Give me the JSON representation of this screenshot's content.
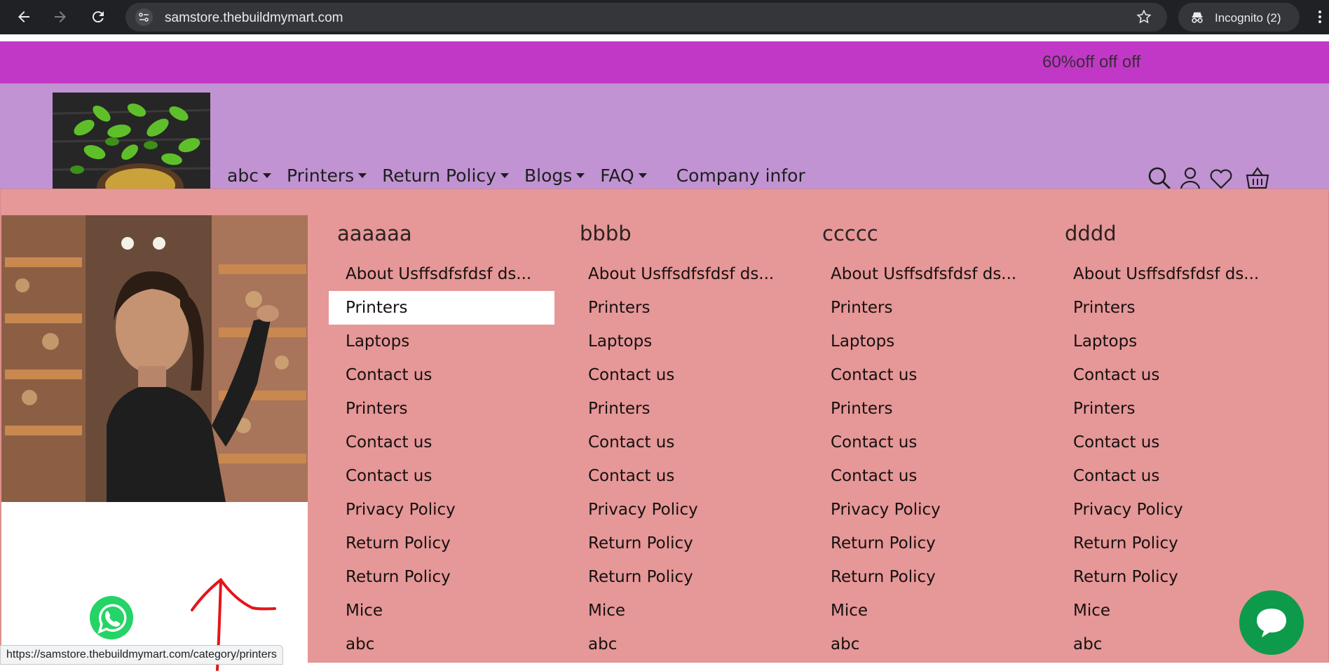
{
  "browser": {
    "url": "samstore.thebuildmymart.com",
    "incognito_label": "Incognito (2)",
    "status_url": "https://samstore.thebuildmymart.com/category/printers"
  },
  "promo": {
    "text": "60%off off off"
  },
  "nav": {
    "items": [
      {
        "label": "abc",
        "dropdown": true
      },
      {
        "label": "Printers",
        "dropdown": true
      },
      {
        "label": "Return Policy",
        "dropdown": true
      },
      {
        "label": "Blogs",
        "dropdown": true
      },
      {
        "label": "FAQ",
        "dropdown": true
      },
      {
        "label": "Company infor",
        "dropdown": false
      }
    ]
  },
  "header_icons": [
    "search-icon",
    "user-icon",
    "heart-icon",
    "basket-icon"
  ],
  "mega_menu": {
    "columns": [
      {
        "title": "aaaaaa",
        "links": [
          "About Usffsdfsfdsf ds...",
          "Printers",
          "Laptops",
          "Contact us",
          "Printers",
          "Contact us",
          "Contact us",
          "Privacy Policy",
          "Return Policy",
          "Return Policy",
          "Mice",
          "abc"
        ]
      },
      {
        "title": "bbbb",
        "links": [
          "About Usffsdfsfdsf ds...",
          "Printers",
          "Laptops",
          "Contact us",
          "Printers",
          "Contact us",
          "Contact us",
          "Privacy Policy",
          "Return Policy",
          "Return Policy",
          "Mice",
          "abc"
        ]
      },
      {
        "title": "ccccc",
        "links": [
          "About Usffsdfsfdsf ds...",
          "Printers",
          "Laptops",
          "Contact us",
          "Printers",
          "Contact us",
          "Contact us",
          "Privacy Policy",
          "Return Policy",
          "Return Policy",
          "Mice",
          "abc"
        ]
      },
      {
        "title": "dddd",
        "links": [
          "About Usffsdfsfdsf ds...",
          "Printers",
          "Laptops",
          "Contact us",
          "Printers",
          "Contact us",
          "Contact us",
          "Privacy Policy",
          "Return Policy",
          "Return Policy",
          "Mice",
          "abc"
        ]
      }
    ],
    "hovered": {
      "column": 0,
      "link": 1
    }
  },
  "colors": {
    "promo_bar": "#c238c6",
    "header": "#c193d3",
    "mega_menu": "#e69797",
    "chat_button": "#0d9a4b",
    "whatsapp": "#25d366",
    "annotation": "#e3151a"
  }
}
